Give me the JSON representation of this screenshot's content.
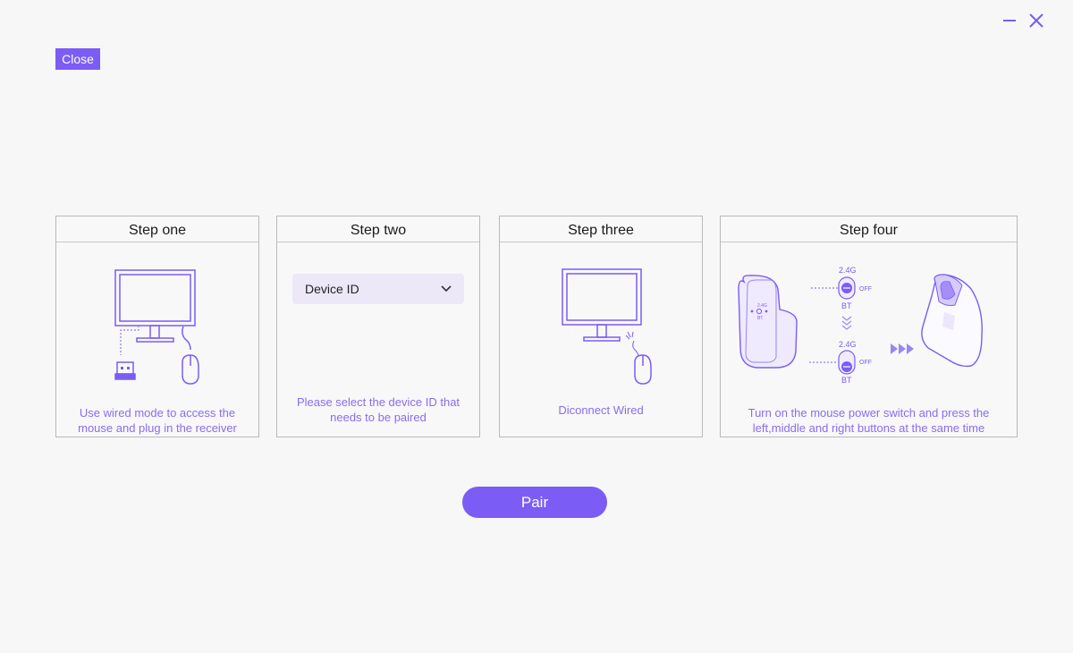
{
  "window": {
    "minimize_icon": "minimize-icon",
    "close_icon": "close-x-icon"
  },
  "close_label": "Close",
  "steps": [
    {
      "title": "Step one",
      "description": "Use wired mode to access the mouse and plug in the receiver"
    },
    {
      "title": "Step two",
      "select_value": "Device ID",
      "description": "Please select the device ID that needs to be paired"
    },
    {
      "title": "Step three",
      "description": "Diconnect Wired"
    },
    {
      "title": "Step four",
      "description": "Turn on the mouse power switch and press the left,middle and right buttons at the same time"
    }
  ],
  "switch": {
    "top_label": "2.4G",
    "bottom_label": "BT",
    "off_label": "OFF"
  },
  "pair_label": "Pair",
  "colors": {
    "accent": "#7b5cf5",
    "description_text": "#8a6cf2",
    "select_bg": "#ece8f8"
  }
}
